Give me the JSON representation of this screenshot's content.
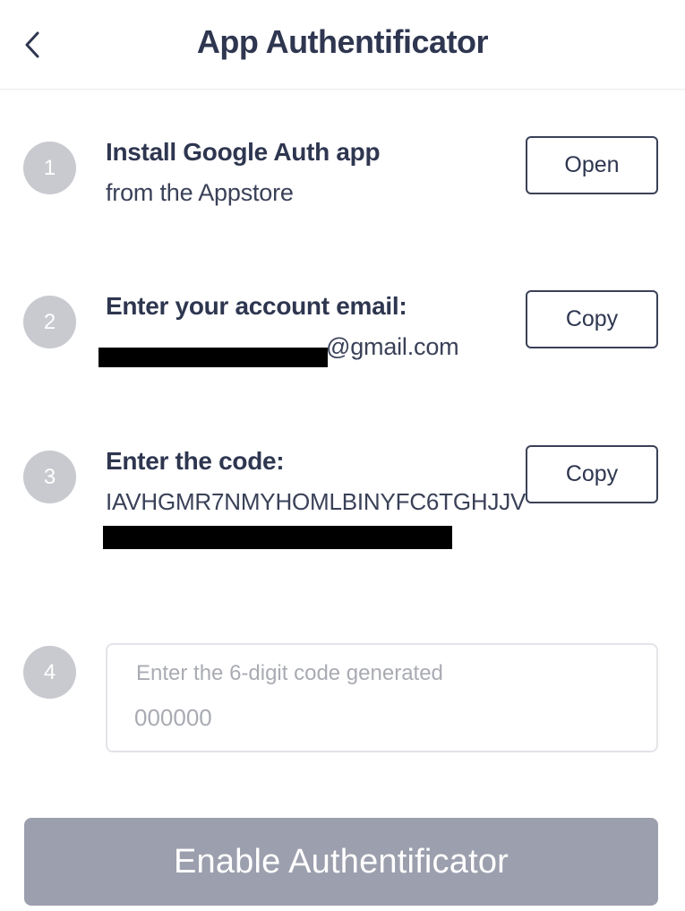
{
  "header": {
    "title": "App Authentificator",
    "back_icon": "chevron-left-icon"
  },
  "steps": [
    {
      "number": "1",
      "title": "Install Google Auth app",
      "subtitle": "from the Appstore",
      "button_label": "Open"
    },
    {
      "number": "2",
      "title": "Enter your account email:",
      "email_visible_part": "@gmail.com",
      "button_label": "Copy"
    },
    {
      "number": "3",
      "title": "Enter the code:",
      "code": "IAVHGMR7NMYHOMLBINYFC6TGHJJV",
      "button_label": "Copy"
    },
    {
      "number": "4",
      "input_label": "Enter the 6-digit code generated",
      "input_placeholder": "000000"
    }
  ],
  "enable_button": {
    "label": "Enable Authentificator"
  },
  "colors": {
    "text_primary": "#2e3650",
    "step_circle": "#c8cad0",
    "button_border": "#3a4158",
    "enable_button_bg": "#9c9fad",
    "input_border": "#e3e4e8",
    "placeholder": "#a9abb3"
  }
}
